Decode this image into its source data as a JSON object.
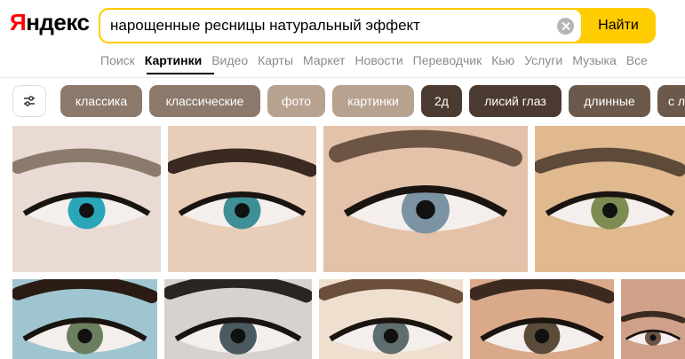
{
  "header": {
    "logo_first": "Я",
    "logo_rest": "ндекс",
    "query": "нарощенные ресницы натуральный эффект",
    "search_button": "Найти"
  },
  "nav": [
    "Поиск",
    "Картинки",
    "Видео",
    "Карты",
    "Маркет",
    "Новости",
    "Переводчик",
    "Кью",
    "Услуги",
    "Музыка",
    "Все"
  ],
  "nav_active": "Картинки",
  "chips": [
    {
      "label": "классика",
      "color": "#8b7a6c"
    },
    {
      "label": "классические",
      "color": "#8b7a6c"
    },
    {
      "label": "фото",
      "color": "#b7a290"
    },
    {
      "label": "картинки",
      "color": "#b7a290"
    },
    {
      "label": "2д",
      "color": "#4b3a2f"
    },
    {
      "label": "лисий глаз",
      "color": "#4b3a2f"
    },
    {
      "label": "длинные",
      "color": "#6b5a4c"
    },
    {
      "label": "с л",
      "color": "#6b5a4c"
    }
  ],
  "images": [
    {
      "name": "eye-photo-1",
      "skin": "#e9dbd4",
      "iris": "#2aa6b8",
      "brow": "#8a7b6d"
    },
    {
      "name": "eye-photo-2",
      "skin": "#e8cdb8",
      "iris": "#3f8f97",
      "brow": "#3a2a22"
    },
    {
      "name": "eye-photo-3",
      "skin": "#e4c2a9",
      "iris": "#7c93a3",
      "brow": "#6d5545"
    },
    {
      "name": "eye-photo-4",
      "skin": "#e0b98f",
      "iris": "#7d8c52",
      "brow": "#5d4a38"
    },
    {
      "name": "eye-photo-5",
      "skin": "#9fc6d0",
      "iris": "#6a7f60",
      "brow": "#2a1c15"
    },
    {
      "name": "eye-photo-6",
      "skin": "#d8d2ce",
      "iris": "#4a5a60",
      "brow": "#2a2422"
    },
    {
      "name": "eye-photo-7",
      "skin": "#efdfcf",
      "iris": "#5f6d6f",
      "brow": "#6c4f3a"
    },
    {
      "name": "eye-photo-8",
      "skin": "#d9a98a",
      "iris": "#5a4b3a",
      "brow": "#3d2a1e"
    },
    {
      "name": "eye-photo-9",
      "skin": "#cfa08a",
      "iris": "#6b5547",
      "brow": "#3b2a20"
    }
  ]
}
